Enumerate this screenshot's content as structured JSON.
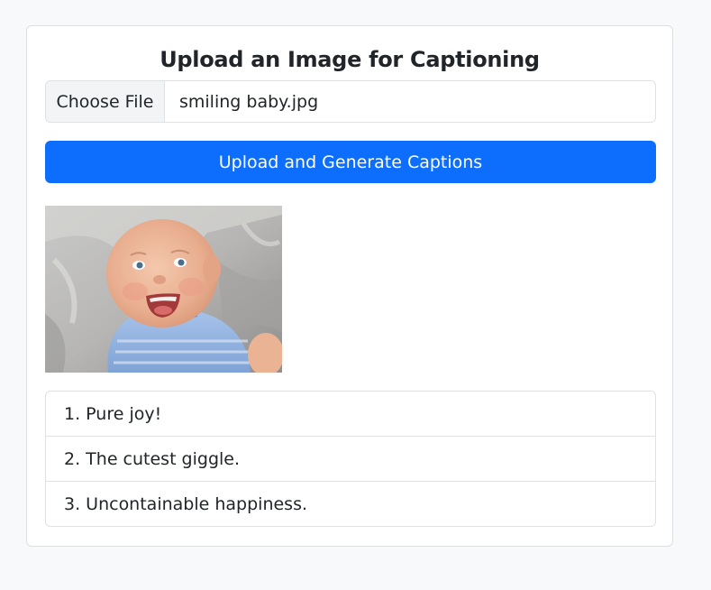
{
  "page": {
    "title": "Upload an Image for Captioning"
  },
  "file_input": {
    "button_label": "Choose File",
    "file_name": "smiling baby.jpg"
  },
  "upload_button": {
    "label": "Upload and Generate Captions"
  },
  "preview_image": {
    "subject": "smiling-baby-photo"
  },
  "captions": [
    "1. Pure joy!",
    "2. The cutest giggle.",
    "3. Uncontainable happiness."
  ],
  "colors": {
    "primary": "#0d6efd",
    "page_background": "#f8f9fa",
    "card_background": "#ffffff",
    "border": "#dee2e6"
  }
}
